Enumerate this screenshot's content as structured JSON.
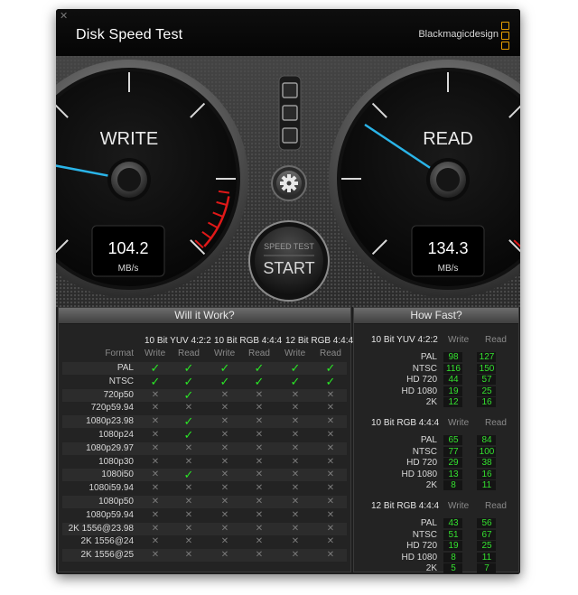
{
  "app": {
    "title": "Disk Speed Test",
    "brand": "Blackmagicdesign",
    "close_glyph": "✕"
  },
  "colors": {
    "needle": "#2ab4e8",
    "redzone": "#e01818",
    "value_green": "#2ae626",
    "accent_orange": "#e8a000"
  },
  "gauges": {
    "write": {
      "label": "WRITE",
      "value": "104.2",
      "unit": "MB/s"
    },
    "read": {
      "label": "READ",
      "value": "134.3",
      "unit": "MB/s"
    }
  },
  "start_button": {
    "top": "SPEED TEST",
    "bottom": "START"
  },
  "settings_icon": "gear-icon",
  "will_it_work": {
    "title": "Will it Work?",
    "format_label": "Format",
    "groups": [
      "10 Bit YUV 4:2:2",
      "10 Bit RGB 4:4:4",
      "12 Bit RGB 4:4:4"
    ],
    "subcols": [
      "Write",
      "Read"
    ],
    "rows": [
      {
        "format": "PAL",
        "marks": [
          1,
          1,
          1,
          1,
          1,
          1
        ]
      },
      {
        "format": "NTSC",
        "marks": [
          1,
          1,
          1,
          1,
          1,
          1
        ]
      },
      {
        "format": "720p50",
        "marks": [
          0,
          1,
          0,
          0,
          0,
          0
        ]
      },
      {
        "format": "720p59.94",
        "marks": [
          0,
          0,
          0,
          0,
          0,
          0
        ]
      },
      {
        "format": "1080p23.98",
        "marks": [
          0,
          1,
          0,
          0,
          0,
          0
        ]
      },
      {
        "format": "1080p24",
        "marks": [
          0,
          1,
          0,
          0,
          0,
          0
        ]
      },
      {
        "format": "1080p29.97",
        "marks": [
          0,
          0,
          0,
          0,
          0,
          0
        ]
      },
      {
        "format": "1080p30",
        "marks": [
          0,
          0,
          0,
          0,
          0,
          0
        ]
      },
      {
        "format": "1080i50",
        "marks": [
          0,
          1,
          0,
          0,
          0,
          0
        ]
      },
      {
        "format": "1080i59.94",
        "marks": [
          0,
          0,
          0,
          0,
          0,
          0
        ]
      },
      {
        "format": "1080p50",
        "marks": [
          0,
          0,
          0,
          0,
          0,
          0
        ]
      },
      {
        "format": "1080p59.94",
        "marks": [
          0,
          0,
          0,
          0,
          0,
          0
        ]
      },
      {
        "format": "2K 1556@23.98",
        "marks": [
          0,
          0,
          0,
          0,
          0,
          0
        ]
      },
      {
        "format": "2K 1556@24",
        "marks": [
          0,
          0,
          0,
          0,
          0,
          0
        ]
      },
      {
        "format": "2K 1556@25",
        "marks": [
          0,
          0,
          0,
          0,
          0,
          0
        ]
      }
    ]
  },
  "how_fast": {
    "title": "How Fast?",
    "subcols": [
      "Write",
      "Read"
    ],
    "groups": [
      {
        "name": "10 Bit YUV 4:2:2",
        "rows": [
          {
            "format": "PAL",
            "write": "98",
            "read": "127"
          },
          {
            "format": "NTSC",
            "write": "116",
            "read": "150"
          },
          {
            "format": "HD 720",
            "write": "44",
            "read": "57"
          },
          {
            "format": "HD 1080",
            "write": "19",
            "read": "25"
          },
          {
            "format": "2K",
            "write": "12",
            "read": "16"
          }
        ]
      },
      {
        "name": "10 Bit RGB 4:4:4",
        "rows": [
          {
            "format": "PAL",
            "write": "65",
            "read": "84"
          },
          {
            "format": "NTSC",
            "write": "77",
            "read": "100"
          },
          {
            "format": "HD 720",
            "write": "29",
            "read": "38"
          },
          {
            "format": "HD 1080",
            "write": "13",
            "read": "16"
          },
          {
            "format": "2K",
            "write": "8",
            "read": "11"
          }
        ]
      },
      {
        "name": "12 Bit RGB 4:4:4",
        "rows": [
          {
            "format": "PAL",
            "write": "43",
            "read": "56"
          },
          {
            "format": "NTSC",
            "write": "51",
            "read": "67"
          },
          {
            "format": "HD 720",
            "write": "19",
            "read": "25"
          },
          {
            "format": "HD 1080",
            "write": "8",
            "read": "11"
          },
          {
            "format": "2K",
            "write": "5",
            "read": "7"
          }
        ]
      }
    ]
  }
}
